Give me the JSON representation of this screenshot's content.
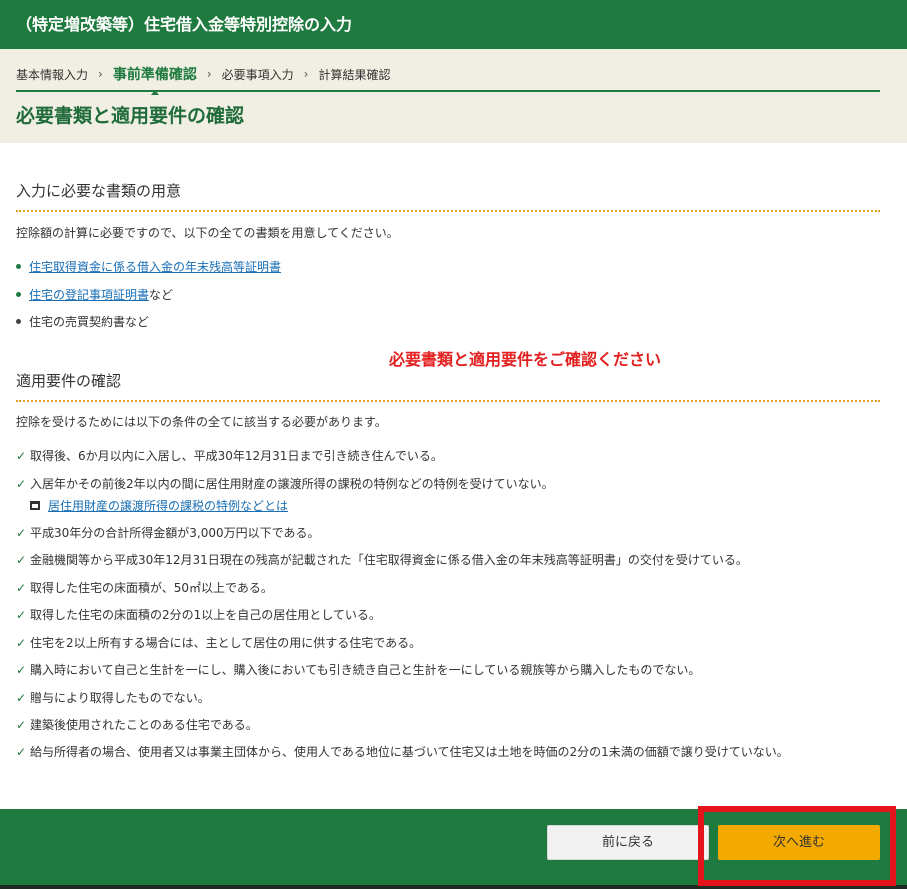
{
  "header": {
    "title": "（特定増改築等）住宅借入金等特別控除の入力"
  },
  "breadcrumb": {
    "steps": [
      "基本情報入力",
      "事前準備確認",
      "必要事項入力",
      "計算結果確認"
    ],
    "separator": "›",
    "current_index": 1
  },
  "page_title": "必要書類と適用要件の確認",
  "documents": {
    "heading": "入力に必要な書類の用意",
    "intro": "控除額の計算に必要ですので、以下の全ての書類を用意してください。",
    "items": [
      {
        "link": "住宅取得資金に係る借入金の年末残高等証明書",
        "suffix": ""
      },
      {
        "link": "住宅の登記事項証明書",
        "suffix": "など"
      },
      {
        "link": "",
        "suffix": "住宅の売買契約書など"
      }
    ]
  },
  "notice": "必要書類と適用要件をご確認ください",
  "requirements": {
    "heading": "適用要件の確認",
    "intro": "控除を受けるためには以下の条件の全てに該当する必要があります。",
    "items": [
      "取得後、6か月以内に入居し、平成30年12月31日まで引き続き住んでいる。",
      "入居年かその前後2年以内の間に居住用財産の譲渡所得の課税の特例などの特例を受けていない。",
      "平成30年分の合計所得金額が3,000万円以下である。",
      "金融機関等から平成30年12月31日現在の残高が記載された「住宅取得資金に係る借入金の年末残高等証明書」の交付を受けている。",
      "取得した住宅の床面積が、50㎡以上である。",
      "取得した住宅の床面積の2分の1以上を自己の居住用としている。",
      "住宅を2以上所有する場合には、主として居住の用に供する住宅である。",
      "購入時において自己と生計を一にし、購入後においても引き続き自己と生計を一にしている親族等から購入したものでない。",
      "贈与により取得したものでない。",
      "建築後使用されたことのある住宅である。",
      "給与所得者の場合、使用者又は事業主団体から、使用人である地位に基づいて住宅又は土地を時価の2分の1未満の価額で譲り受けていない。"
    ],
    "sub_link": "居住用財産の譲渡所得の課税の特例などとは"
  },
  "footer": {
    "back_label": "前に戻る",
    "next_label": "次へ進む"
  },
  "colors": {
    "primary_green": "#1f7a3f",
    "header_bg": "#f1efe3",
    "accent_orange": "#f2a900",
    "notice_red": "#e32020",
    "link_blue": "#1a6fb5"
  }
}
